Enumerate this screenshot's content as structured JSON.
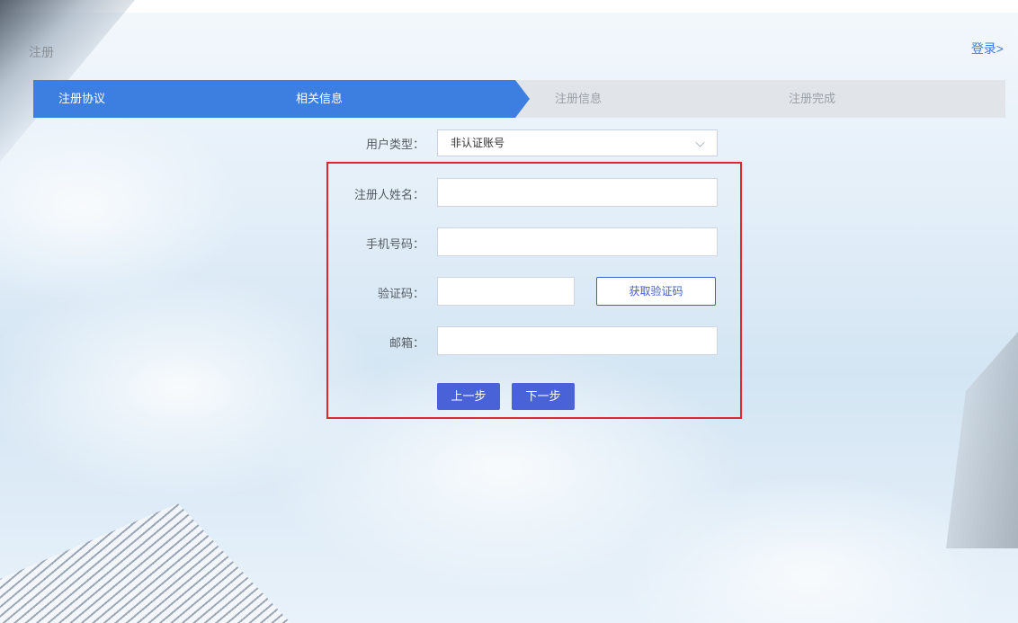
{
  "header": {
    "title": "注册",
    "login_link": "登录>"
  },
  "steps": [
    {
      "label": "注册协议",
      "state": "active"
    },
    {
      "label": "相关信息",
      "state": "active"
    },
    {
      "label": "注册信息",
      "state": "inactive"
    },
    {
      "label": "注册完成",
      "state": "inactive"
    }
  ],
  "form": {
    "user_type": {
      "label": "用户类型：",
      "value": "非认证账号"
    },
    "name": {
      "label": "注册人姓名：",
      "value": ""
    },
    "phone": {
      "label": "手机号码：",
      "value": ""
    },
    "code": {
      "label": "验证码：",
      "value": "",
      "button": "获取验证码"
    },
    "email": {
      "label": "邮箱：",
      "value": ""
    },
    "prev_button": "上一步",
    "next_button": "下一步"
  },
  "colors": {
    "accent": "#3d7fe0",
    "button": "#4a62d8",
    "highlight_border": "#e0272b"
  }
}
